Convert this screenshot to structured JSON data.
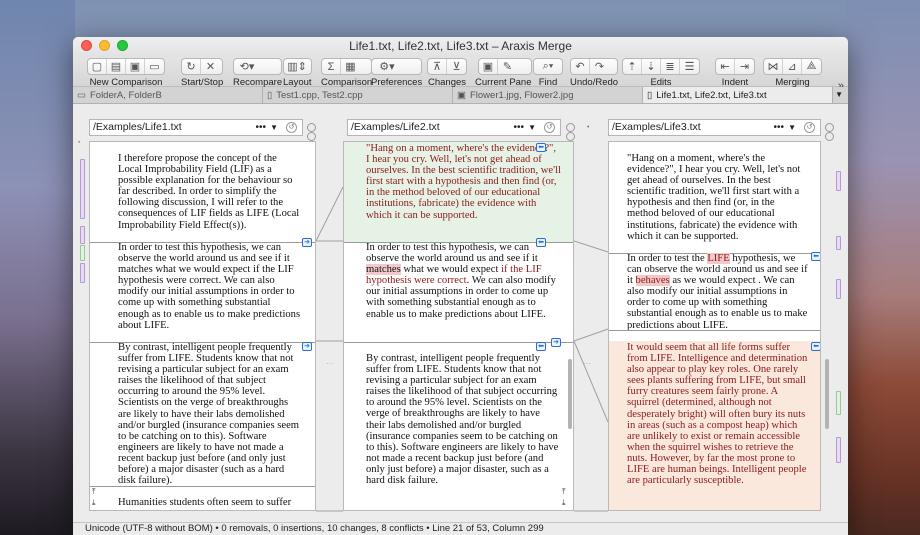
{
  "window": {
    "title": "Life1.txt, Life2.txt, Life3.txt – Araxis Merge"
  },
  "toolbar": [
    {
      "label": "New Comparison",
      "icons": [
        "new-file-icon",
        "new-folder-icon",
        "new-image-icon",
        "new-window-icon"
      ]
    },
    {
      "label": "Start/Stop",
      "icons": [
        "refresh-icon",
        "stop-icon"
      ]
    },
    {
      "label": "Recompare",
      "icons": [
        "recompare-icon"
      ]
    },
    {
      "label": "Layout",
      "icons": [
        "layout-icon"
      ]
    },
    {
      "label": "Comparison",
      "icons": [
        "sigma-icon",
        "compare-icon"
      ]
    },
    {
      "label": "Preferences",
      "icons": [
        "gear-icon"
      ]
    },
    {
      "label": "Changes",
      "icons": [
        "prev-change-icon",
        "next-change-icon"
      ]
    },
    {
      "label": "Current Pane",
      "icons": [
        "save-icon",
        "edit-icon"
      ]
    },
    {
      "label": "Find",
      "icons": [
        "search-icon"
      ]
    },
    {
      "label": "Undo/Redo",
      "icons": [
        "undo-icon",
        "redo-icon"
      ]
    },
    {
      "label": "Edits",
      "icons": [
        "edit-a-icon",
        "edit-b-icon",
        "edit-c-icon",
        "edit-d-icon"
      ]
    },
    {
      "label": "Indent",
      "icons": [
        "outdent-icon",
        "indent-icon"
      ]
    },
    {
      "label": "Merging",
      "icons": [
        "merge-a-icon",
        "merge-b-icon",
        "merge-c-icon"
      ]
    }
  ],
  "tabs": [
    {
      "label": "FolderA, FolderB",
      "active": false
    },
    {
      "label": "Test1.cpp, Test2.cpp",
      "active": false
    },
    {
      "label": "Flower1.jpg, Flower2.jpg",
      "active": false
    },
    {
      "label": "Life1.txt, Life2.txt, Life3.txt",
      "active": true
    }
  ],
  "panes": [
    {
      "path": "/Examples/Life1.txt",
      "blocks": [
        "I therefore propose the concept of the Local Improbability Field (LIF) as a possible explanation for the behaviour so far described. In order to simplify the following discussion, I will refer to the consequences of LIF fields as LIFE (Local Improbability Field Effect(s)).",
        "In order to test this hypothesis, we can observe the world around us and see if it matches what we would expect if the LIF hypothesis were correct. We can also modify our initial assumptions in order to come up with something substantial enough as to enable us to make predictions about LIFE.",
        "By contrast, intelligent people frequently suffer from LIFE. Students know that not revising a particular subject for an exam raises the likelihood of that subject occurring to around the 95% level. Scientists on the verge of breakthroughs are likely to have their labs demolished and/or burgled (insurance companies seem to be catching on to this). Software engineers are likely to have not made a recent backup just before (and only just before) a major disaster  (such as a hard disk failure).",
        "Humanities students often seem to suffer"
      ]
    },
    {
      "path": "/Examples/Life2.txt",
      "blocks": [
        "\"Hang on a moment, where's the evidence?\", I hear you cry. Well, let's not get ahead of ourselves. In the best scientific tradition, we'll first start with a hypothesis and then find (or, in the method beloved of our educational institutions, fabricate) the evidence with which it can be supported.",
        "In order to test this hypothesis, we can observe the world around us and see if it matches what we would expect if the LIF hypothesis were correct. We can also modify our initial assumptions in order to come up with something substantial enough as to enable us to make predictions about LIFE.",
        "By contrast, intelligent people frequently suffer from LIFE. Students know that not revising a particular subject for an exam raises the likelihood of that subject occurring to around the 95% level. Scientists on the verge of breakthroughs are likely to have their labs demolished and/or burgled (insurance companies seem to be catching on to this). Software engineers are likely to have not made a recent backup just before (and only just before) a major disaster,  such as a hard disk failure."
      ]
    },
    {
      "path": "/Examples/Life3.txt",
      "blocks": [
        "\"Hang on a moment, where's the evidence?\", I hear you cry. Well, let's not get ahead of ourselves. In the best scientific tradition, we'll first start with a hypothesis and then find (or, in the method beloved of our educational institutions, fabricate) the evidence with which it can be supported.",
        "In order to test the LIFE hypothesis, we can observe the world around us and see if it behaves  as we would expect . We can also modify our initial assumptions in order to come up with something substantial enough as to enable us to make predictions about LIFE.",
        "It would seem that all life forms suffer from LIFE. Intelligence and determination also appear to play key roles. One rarely sees plants suffering from LIFE, but small furry creatures seem fairly prone. A squirrel (determined, although not desperately bright) will often bury its nuts in areas (such as a compost heap) which are unlikely to exist or remain accessible when the squirrel wishes to retrieve the nuts. However, by far the most prone to LIFE are human beings. Intelligent people are particularly susceptible."
      ]
    }
  ],
  "status": "Unicode (UTF-8 without BOM) • 0 removals, 0 insertions, 10 changes, 8 conflicts • Line 21 of 53, Column 299",
  "colors": {
    "conflict": "#fbe8dc",
    "change": "#e6f2e6",
    "changed_text": "#8b1a1a",
    "link_arrow": "#2a6fd0"
  }
}
